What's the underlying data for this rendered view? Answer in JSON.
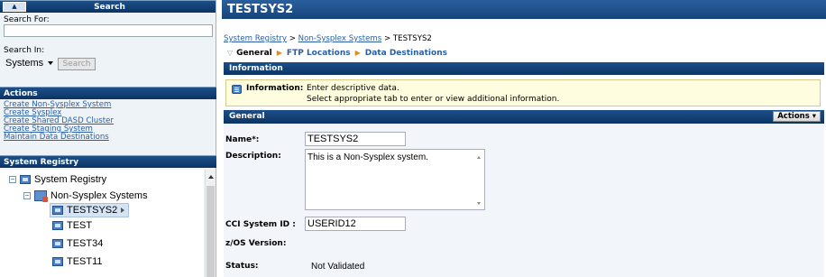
{
  "left": {
    "search_header": "Search",
    "search_for_label": "Search For:",
    "search_for_value": "",
    "search_in_label": "Search In:",
    "search_in_value": "Systems",
    "search_button": "Search",
    "actions_header": "Actions",
    "actions": [
      "Create Non-Sysplex System",
      "Create Sysplex",
      "Create Shared DASD Cluster",
      "Create Staging System",
      "Maintain Data Destinations"
    ],
    "registry_header": "System Registry",
    "tree": {
      "root": "System Registry",
      "group": "Non-Sysplex Systems",
      "systems": [
        "TESTSYS2",
        "TEST",
        "TEST34",
        "TEST11"
      ]
    }
  },
  "main": {
    "title": "TESTSYS2",
    "breadcrumb": [
      "System Registry",
      ">",
      "Non-Sysplex Systems",
      ">",
      "TESTSYS2"
    ],
    "tabs": [
      "General",
      "FTP Locations",
      "Data Destinations"
    ],
    "info_header": "Information",
    "info_label": "Information:",
    "info_line1": "Enter descriptive data.",
    "info_line2": "Select appropriate tab to enter or view additional information.",
    "general_header": "General",
    "actions_button": "Actions",
    "fields": {
      "name_label": "Name*:",
      "name_value": "TESTSYS2",
      "description_label": "Description:",
      "description_value": "This is a Non-Sysplex system.",
      "cci_label": "CCI System ID :",
      "cci_value": "USERID12",
      "zos_label": "z/OS Version:",
      "status_label": "Status:",
      "status_value": "Not Validated"
    }
  },
  "colors": {
    "header_blue": "#0c3463",
    "link_blue": "#2b5fa4",
    "info_bg": "#fffde0",
    "tab_separator": "#e38a1e"
  }
}
